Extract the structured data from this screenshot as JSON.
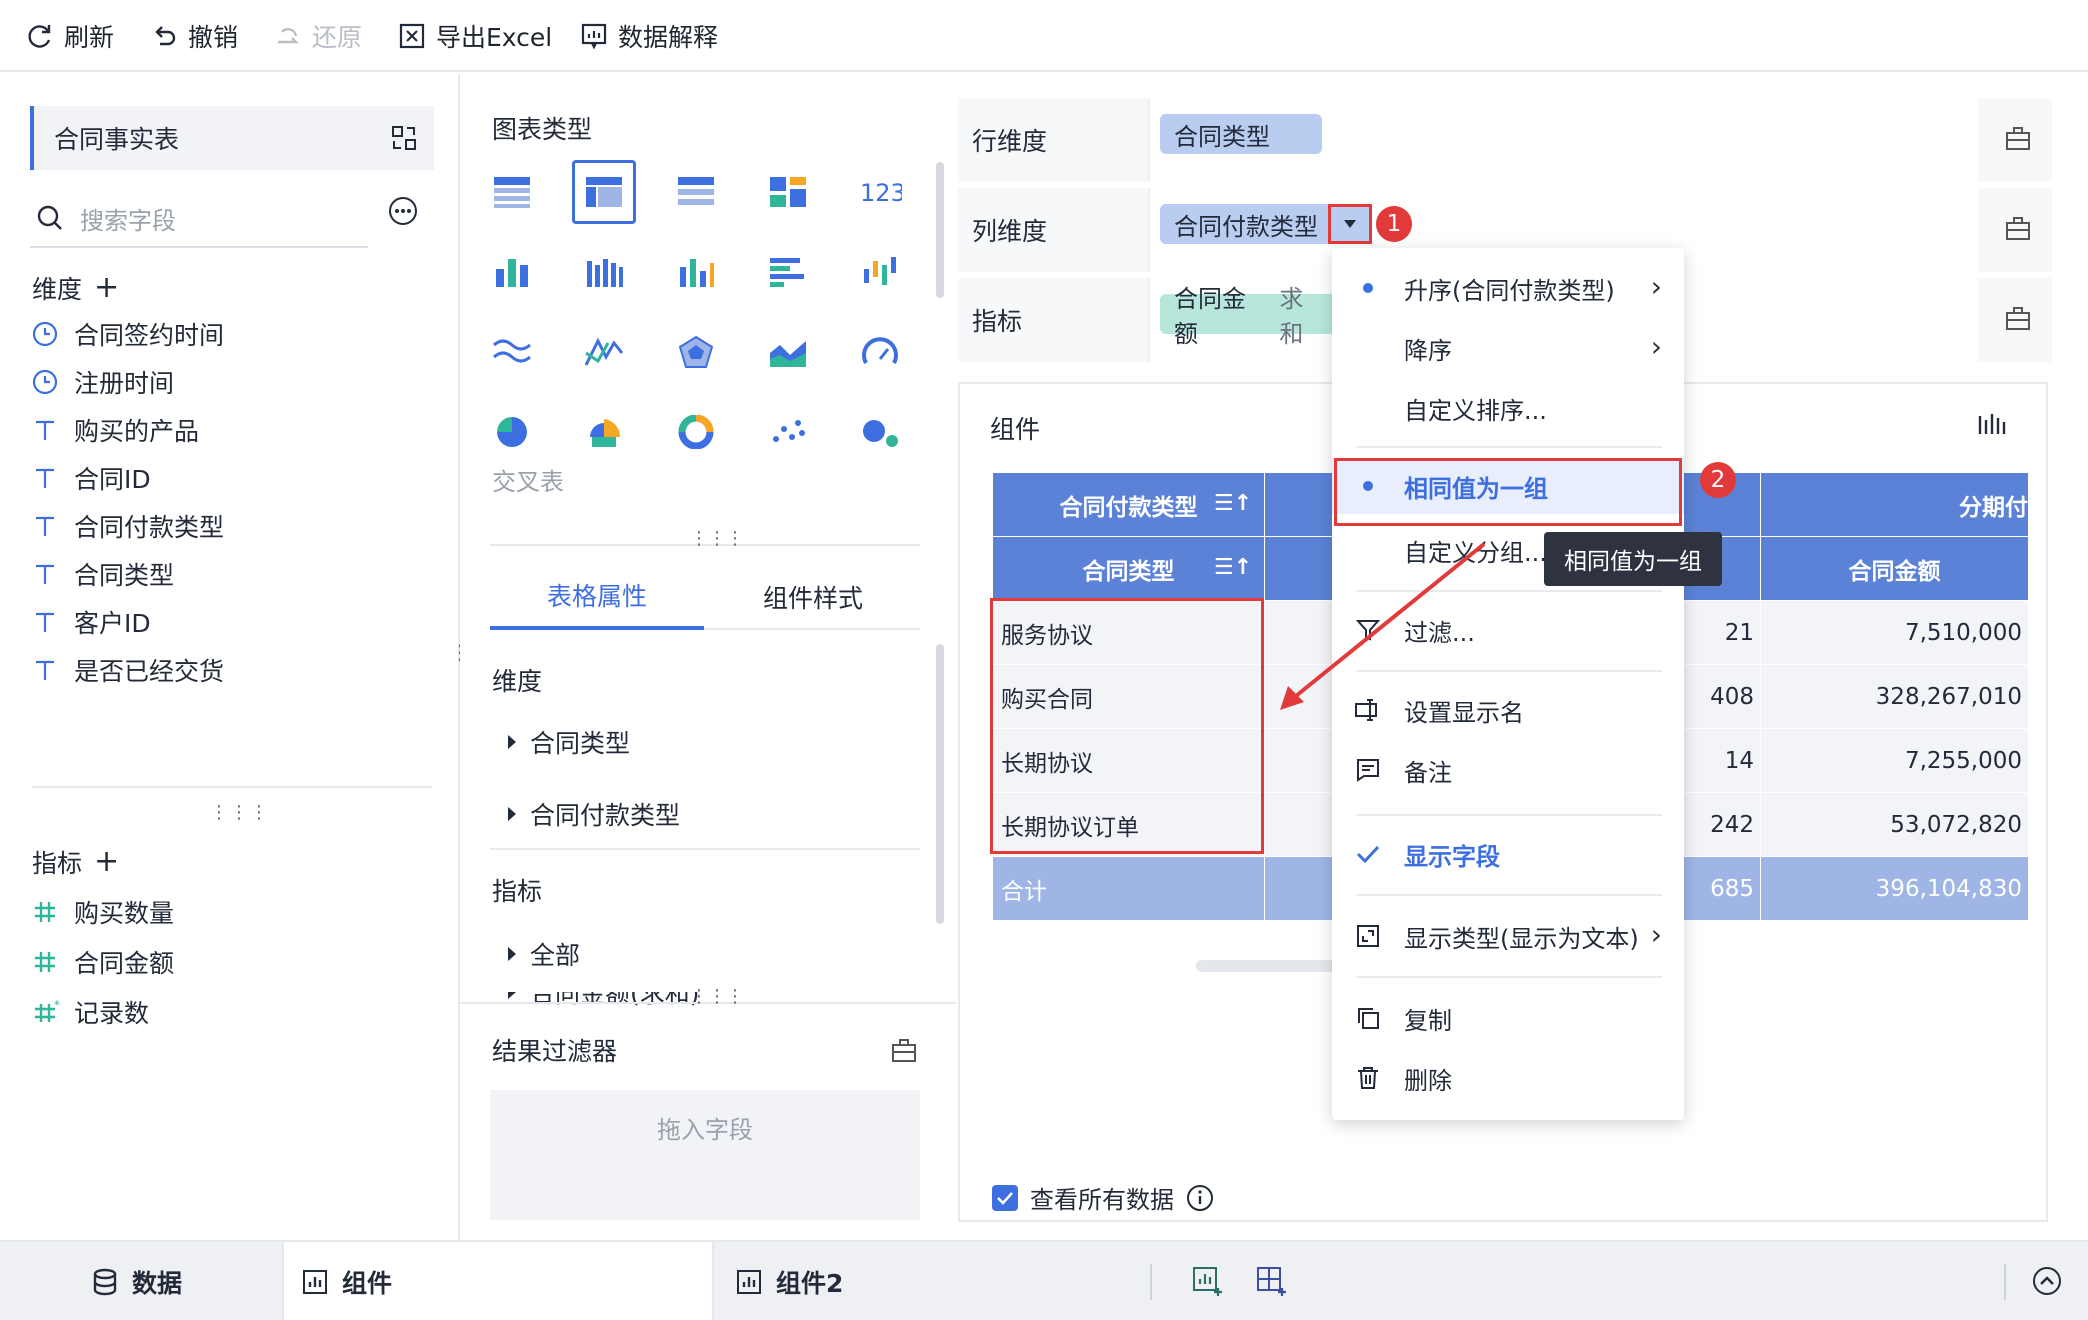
{
  "toolbar": {
    "refresh": "刷新",
    "undo": "撤销",
    "redo": "还原",
    "export": "导出Excel",
    "explain": "数据解释"
  },
  "left": {
    "dataset": "合同事实表",
    "search_placeholder": "搜索字段",
    "dim_title": "维度",
    "dimensions": [
      {
        "icon": "clock-icon",
        "label": "合同签约时间"
      },
      {
        "icon": "clock-icon",
        "label": "注册时间"
      },
      {
        "icon": "text-field-icon",
        "label": "购买的产品"
      },
      {
        "icon": "text-field-icon",
        "label": "合同ID"
      },
      {
        "icon": "text-field-icon",
        "label": "合同付款类型"
      },
      {
        "icon": "text-field-icon",
        "label": "合同类型"
      },
      {
        "icon": "text-field-icon",
        "label": "客户ID"
      },
      {
        "icon": "text-field-icon",
        "label": "是否已经交货"
      }
    ],
    "metric_title": "指标",
    "metrics": [
      {
        "icon": "hash-icon",
        "label": "购买数量"
      },
      {
        "icon": "hash-icon",
        "label": "合同金额"
      },
      {
        "icon": "hash-star-icon",
        "label": "记录数"
      }
    ]
  },
  "middle": {
    "chart_type_title": "图表类型",
    "chart_type_current": "交叉表",
    "tabs": [
      "表格属性",
      "组件样式"
    ],
    "props_dim_title": "维度",
    "props_dims": [
      "合同类型",
      "合同付款类型"
    ],
    "props_metric_title": "指标",
    "props_metrics": [
      "全部",
      "合同金额(求和)"
    ],
    "filter_title": "结果过滤器",
    "drop_hint": "拖入字段"
  },
  "wells": {
    "row_label": "行维度",
    "row_pill": "合同类型",
    "col_label": "列维度",
    "col_pill": "合同付款类型",
    "metric_label": "指标",
    "metric_pill": "合同金额",
    "metric_agg": "求和"
  },
  "component": {
    "title": "组件",
    "header_row1": [
      "合同付款类型",
      "分期付"
    ],
    "header_row2": [
      "合同类型",
      "合同金额"
    ],
    "rows": [
      {
        "name": "服务协议",
        "count": "21",
        "amount": "7,510,000"
      },
      {
        "name": "购买合同",
        "count": "408",
        "amount": "328,267,010"
      },
      {
        "name": "长期协议",
        "count": "14",
        "amount": "7,255,000"
      },
      {
        "name": "长期协议订单",
        "count": "242",
        "amount": "53,072,820"
      }
    ],
    "total": {
      "name": "合计",
      "count": "685",
      "amount": "396,104,830"
    },
    "view_all": "查看所有数据",
    "view_all_checked": true
  },
  "menu": {
    "asc": "升序(合同付款类型)",
    "desc": "降序",
    "custom_sort": "自定义排序...",
    "same_group": "相同值为一组",
    "custom_group": "自定义分组...",
    "filter": "过滤...",
    "rename": "设置显示名",
    "note": "备注",
    "show_field": "显示字段",
    "display_type": "显示类型(显示为文本)",
    "copy": "复制",
    "delete": "删除"
  },
  "tooltip": "相同值为一组",
  "badges": [
    "1",
    "2"
  ],
  "bottom": {
    "data": "数据",
    "comp1": "组件",
    "comp2": "组件2"
  },
  "colors": {
    "accent": "#3d6fe0",
    "header": "#5b82d6",
    "annotation": "#e23a3a"
  }
}
